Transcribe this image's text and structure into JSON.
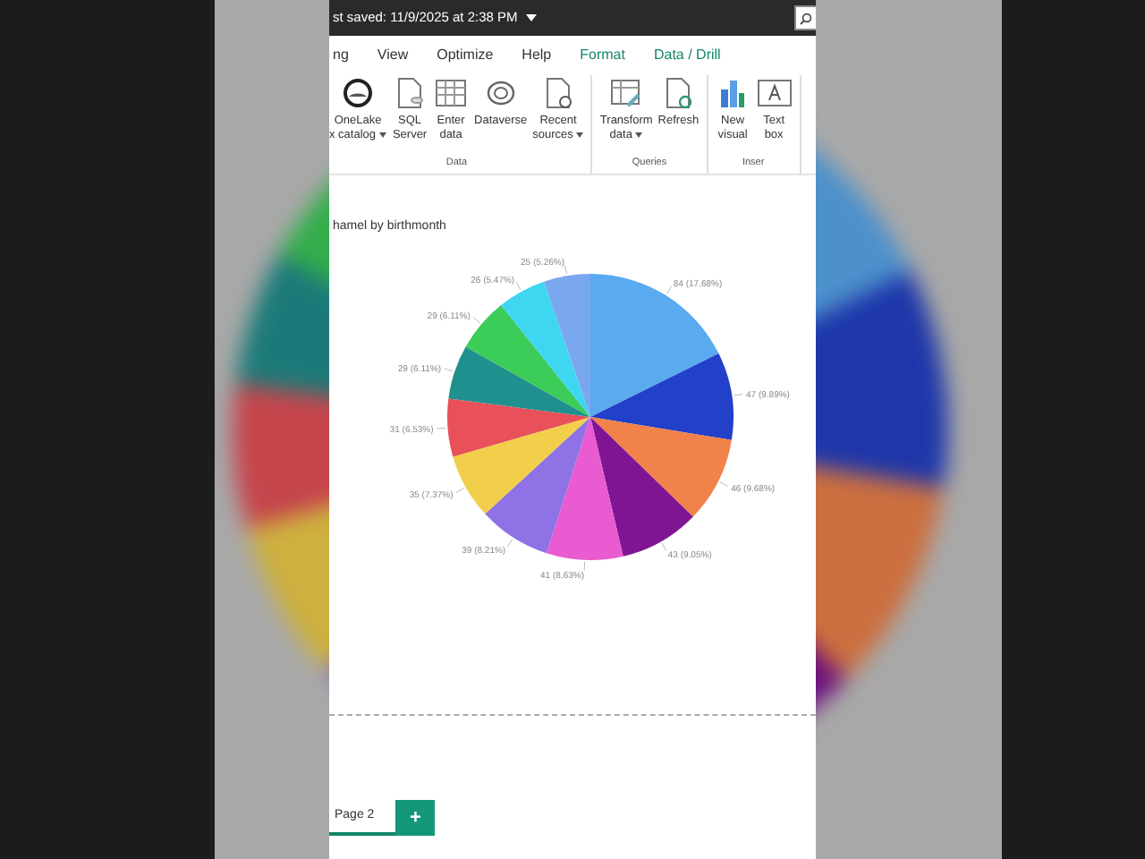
{
  "title_bar": {
    "text": "st saved: 11/9/2025 at 2:38 PM"
  },
  "menu_tabs": [
    {
      "label": "ng",
      "kind": "normal"
    },
    {
      "label": "View",
      "kind": "normal"
    },
    {
      "label": "Optimize",
      "kind": "normal"
    },
    {
      "label": "Help",
      "kind": "normal"
    },
    {
      "label": "Format",
      "kind": "contextual"
    },
    {
      "label": "Data / Drill",
      "kind": "contextual"
    }
  ],
  "ribbon_groups": [
    {
      "label": "Data",
      "buttons": [
        {
          "lines": [
            "OneLake",
            "x catalog"
          ],
          "dropdown": true
        },
        {
          "lines": [
            "SQL",
            "Server"
          ],
          "dropdown": false
        },
        {
          "lines": [
            "Enter",
            "data"
          ],
          "dropdown": false
        },
        {
          "lines": [
            "Dataverse"
          ],
          "dropdown": false
        },
        {
          "lines": [
            "Recent",
            "sources"
          ],
          "dropdown": true
        }
      ]
    },
    {
      "label": "Queries",
      "buttons": [
        {
          "lines": [
            "Transform",
            "data"
          ],
          "dropdown": true
        },
        {
          "lines": [
            "Refresh"
          ],
          "dropdown": false
        }
      ]
    },
    {
      "label": "Inser",
      "buttons": [
        {
          "lines": [
            "New",
            "visual"
          ],
          "dropdown": false
        },
        {
          "lines": [
            "Text",
            "box"
          ],
          "dropdown": false
        }
      ]
    }
  ],
  "visual": {
    "chart_data": {
      "type": "pie",
      "title": "hamel by birthmonth",
      "values": [
        84,
        47,
        46,
        43,
        41,
        39,
        35,
        31,
        29,
        29,
        26,
        25
      ],
      "value_labels": [
        "84 (17.68%)",
        "47 (9.89%)",
        "46 (9.68%)",
        "43 (9.05%)",
        "41 (8.63%)",
        "39 (8.21%)",
        "35 (7.37%)",
        "31 (6.53%)",
        "29 (6.11%)",
        "29 (6.11%)",
        "26 (5.47%)",
        "25 (5.26%)"
      ],
      "colors": [
        "#5aaaf0",
        "#2340c8",
        "#f0824a",
        "#7f1593",
        "#ea5ad0",
        "#8f72e6",
        "#f2cf4a",
        "#e8515a",
        "#20908e",
        "#3ccc58",
        "#3fd6f2",
        "#7aa8ee"
      ]
    }
  },
  "page_tabs": [
    {
      "label": "Page 2",
      "selected": true
    }
  ],
  "add_page_button": "+"
}
